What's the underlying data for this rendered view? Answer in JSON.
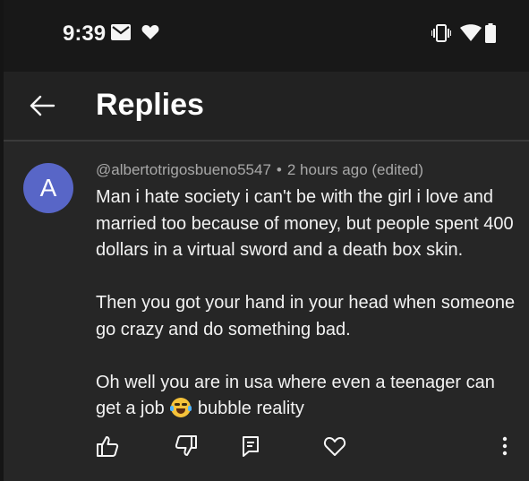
{
  "status_bar": {
    "time": "9:39",
    "left_icons": [
      "mail-icon",
      "heart-icon"
    ],
    "right_icons": [
      "vibrate-icon",
      "wifi-icon",
      "battery-icon"
    ]
  },
  "header": {
    "title": "Replies",
    "back_icon": "arrow-left-icon"
  },
  "comment": {
    "avatar_letter": "A",
    "avatar_color": "#5866c7",
    "author": "@albertotrigosbueno5547",
    "separator": "•",
    "time": "2 hours ago (edited)",
    "paragraphs": [
      "Man i hate society i can't be with the girl i love and married too because of money, but people spent 400 dollars in a virtual sword  and a death box skin.",
      "Then you got your hand in your head when someone go crazy and do something bad.",
      "Oh well you are in usa where even a teenager can get a job"
    ],
    "last_paragraph_tail": "bubble reality",
    "emoji": "laughing-tears-emoji"
  },
  "actions": [
    "like-icon",
    "dislike-icon",
    "reply-icon",
    "heart-icon",
    "more-vert-icon"
  ],
  "colors": {
    "background": "#262626",
    "header": "#222222",
    "status_bar": "#181818",
    "meta_text": "#a8a8a8"
  }
}
